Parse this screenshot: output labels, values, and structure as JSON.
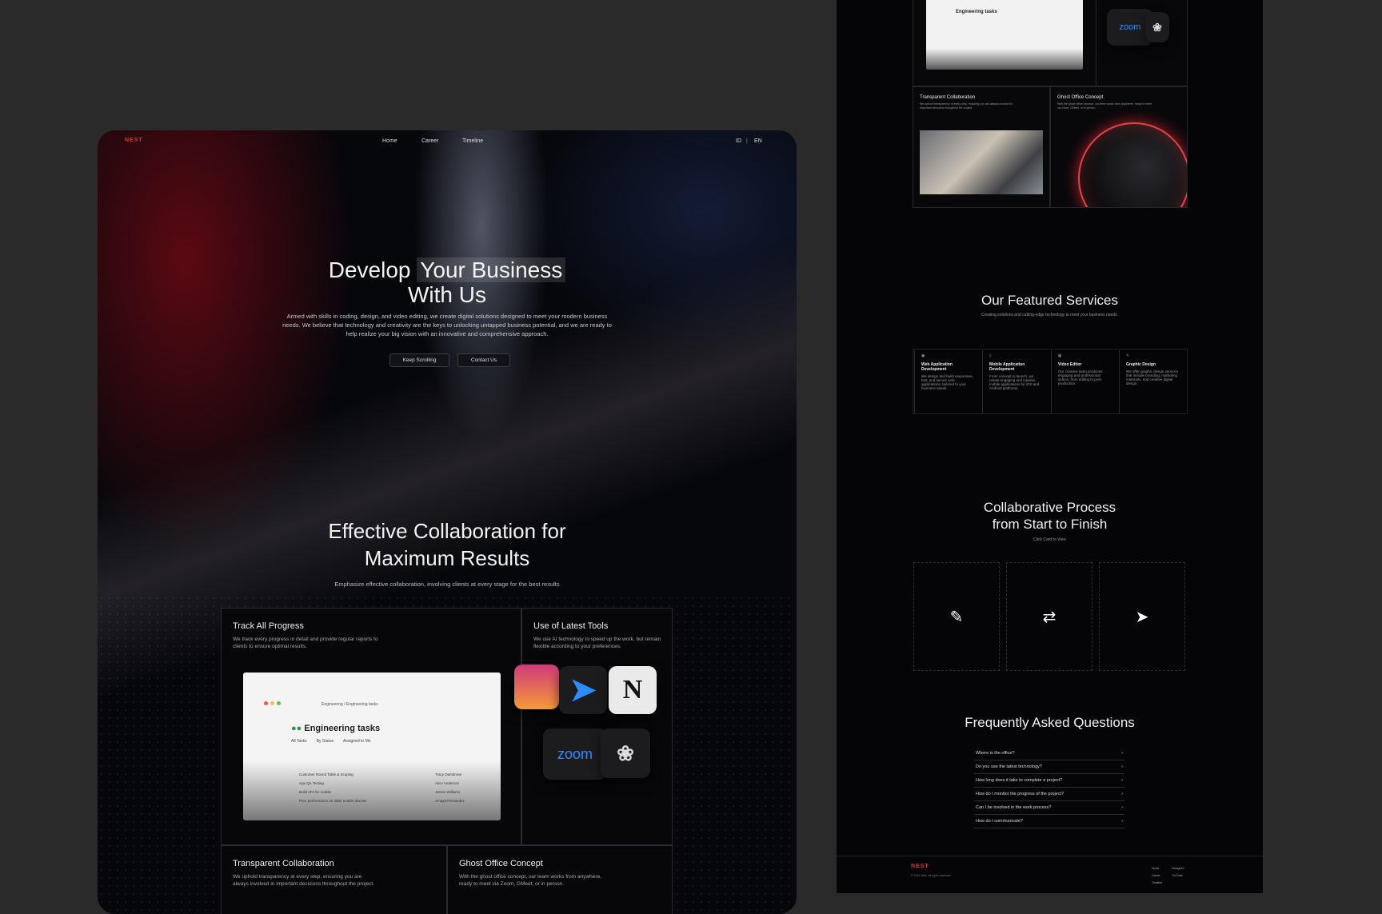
{
  "nav": {
    "logo": "NEST",
    "links": [
      "Home",
      "Career",
      "Timeline"
    ],
    "lang_id": "ID",
    "lang_sep": "|",
    "lang_en": "EN"
  },
  "hero": {
    "title_a": "Develop",
    "title_b": "Your Business",
    "title_c": "With Us",
    "desc": "Armed with skills in coding, design, and video editing, we create digital solutions designed to meet your modern business needs. We believe that technology and creativity are the keys to unlocking untapped business potential, and we are ready to help realize your big vision with an innovative and comprehensive approach.",
    "btn1": "Keep Scrolling",
    "btn2": "Contact Us"
  },
  "collab": {
    "title1": "Effective Collaboration for",
    "title2": "Maximum Results",
    "sub": "Emphasize effective collaboration, involving clients at every stage for the best results",
    "track_title": "Track All Progress",
    "track_desc": "We track every progress in detail and provide regular reports to clients to ensure optimal results.",
    "tools_title": "Use of Latest Tools",
    "tools_desc": "We use AI technology to speed up the work, but remain flexible according to your preferences.",
    "transp_title": "Transparent Collaboration",
    "transp_desc": "We uphold transparency at every step, ensuring you are always involved in important decisions throughout the project.",
    "ghost_title": "Ghost Office Concept",
    "ghost_desc": "With the ghost office concept, our team works from anywhere, ready to meet via Zoom, GMeet, or in person."
  },
  "tasks": {
    "breadcrumb": "Engineering / Engineering tasks",
    "title": "Engineering tasks",
    "tabs": [
      "All Tasks",
      "By Status",
      "Assigned to Me"
    ],
    "items": [
      "Customer Round Table & Scoping",
      "App QA Testing",
      "Build 2FA for mobile",
      "Poor performance on older mobile devices"
    ],
    "owners": [
      "Tracy Dambrose",
      "Alice Anderson",
      "James Williams",
      "Amaya Fernandez"
    ]
  },
  "tools": {
    "zoom": "zoom",
    "notion": "N"
  },
  "services": {
    "title": "Our Featured Services",
    "sub": "Creating solutions and cutting-edge technology to meet your business needs.",
    "items": [
      {
        "name": "Web Application Development",
        "desc": "We design and build responsive, fast, and secure web applications, tailored to your business needs."
      },
      {
        "name": "Mobile Application Development",
        "desc": "From concept to launch, we create engaging and intuitive mobile applications for iOS and Android platforms."
      },
      {
        "name": "Video Editor",
        "desc": "Our creative team produces engaging and professional videos, from editing to post-production."
      },
      {
        "name": "Graphic Design",
        "desc": "We offer graphic design services that include branding, marketing materials, and creative digital design."
      }
    ]
  },
  "process": {
    "title1": "Collaborative Process",
    "title2": "from Start to Finish",
    "sub": "Click Card to View"
  },
  "faq": {
    "title": "Frequently Asked Questions",
    "items": [
      "Where is the office?",
      "Do you use the latest technology?",
      "How long does it take to complete a project?",
      "How do I monitor the progress of the project?",
      "Can I be involved in the work process?",
      "How do I communicate?"
    ]
  },
  "footer": {
    "logo": "NEST",
    "copy": "© 2024 Nest. All rights reserved.",
    "links": [
      "Home",
      "Instagram",
      "Career",
      "YouTube",
      "Timeline"
    ]
  }
}
